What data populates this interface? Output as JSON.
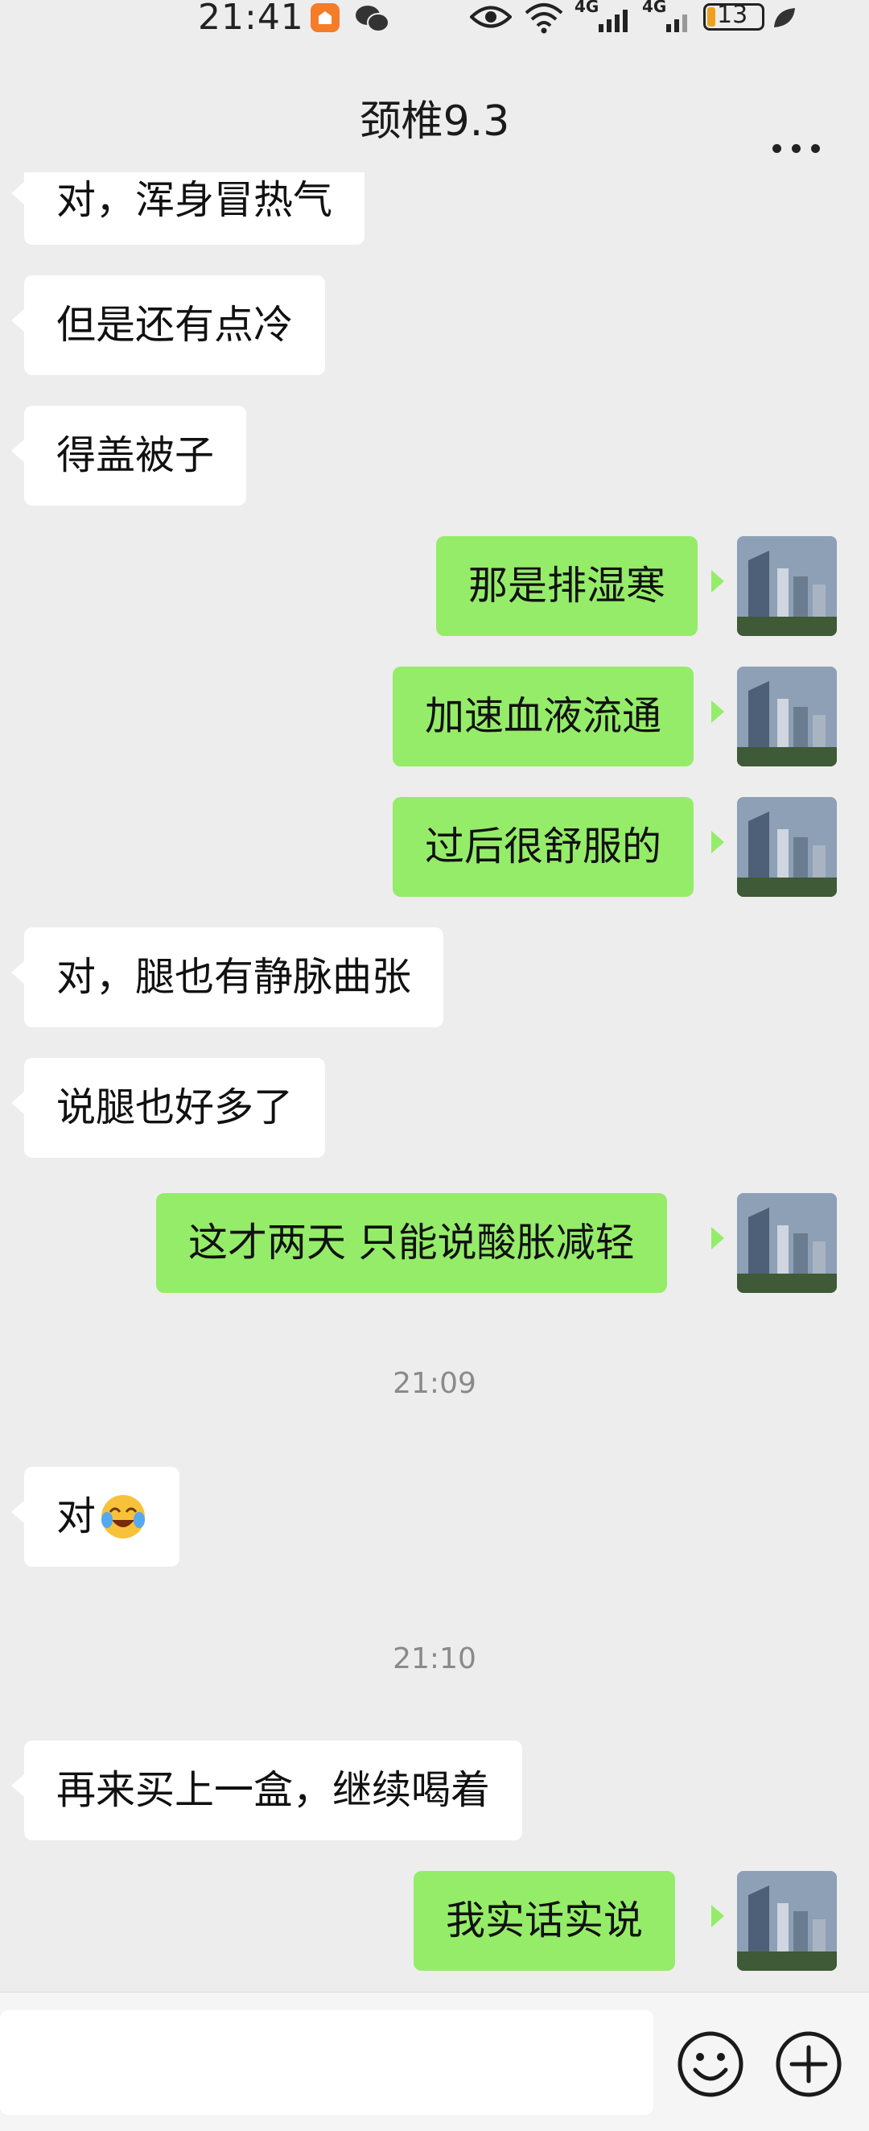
{
  "status_bar": {
    "time": "21:41",
    "battery": "13",
    "network_1": "4G",
    "network_2": "4G"
  },
  "header": {
    "title": "颈椎9.3"
  },
  "messages": [
    {
      "side": "in",
      "text": "对，浑身冒热气"
    },
    {
      "side": "in",
      "text": "但是还有点冷"
    },
    {
      "side": "in",
      "text": "得盖被子"
    },
    {
      "side": "out",
      "text": "那是排湿寒"
    },
    {
      "side": "out",
      "text": "加速血液流通"
    },
    {
      "side": "out",
      "text": "过后很舒服的"
    },
    {
      "side": "in",
      "text": "对，腿也有静脉曲张"
    },
    {
      "side": "in",
      "text": "说腿也好多了"
    },
    {
      "side": "out",
      "text": "这才两天  只能说酸胀减轻"
    },
    {
      "side": "time",
      "text": "21:09"
    },
    {
      "side": "in",
      "text": "对",
      "emoji": "laugh-cry-emoji"
    },
    {
      "side": "time",
      "text": "21:10"
    },
    {
      "side": "in",
      "text": "再来买上一盒，继续喝着"
    },
    {
      "side": "out",
      "text": "我实话实说"
    }
  ],
  "input_bar": {
    "placeholder": "",
    "icons": [
      "smiley-icon",
      "plus-icon"
    ]
  },
  "colors": {
    "background": "#ededed",
    "incoming_bubble": "#ffffff",
    "outgoing_bubble": "#95ec69"
  }
}
